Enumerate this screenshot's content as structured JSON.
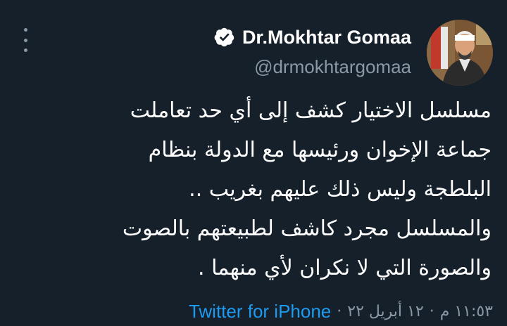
{
  "author": {
    "display_name": "Dr.Mokhtar Gomaa",
    "handle": "@drmokhtargomaa",
    "verified_icon": "verified-badge-icon",
    "avatar_icon": "profile-photo"
  },
  "tweet": {
    "lines": [
      "مسلسل الاختيار كشف إلى أي حد تعاملت",
      "جماعة الإخوان ورئيسها مع الدولة بنظام",
      "البلطجة وليس ذلك عليهم بغريب ..",
      "والمسلسل مجرد كاشف لطبيعتهم بالصوت",
      "والصورة التي لا نكران لأي منهما ."
    ]
  },
  "meta": {
    "time": "١١:٥٣ م",
    "date": "١٢ أبريل ٢٢",
    "separator": "·",
    "source": "Twitter for iPhone"
  },
  "colors": {
    "background": "#15202b",
    "text": "#ffffff",
    "secondary": "#8b98a5",
    "accent": "#1d9bf0"
  }
}
